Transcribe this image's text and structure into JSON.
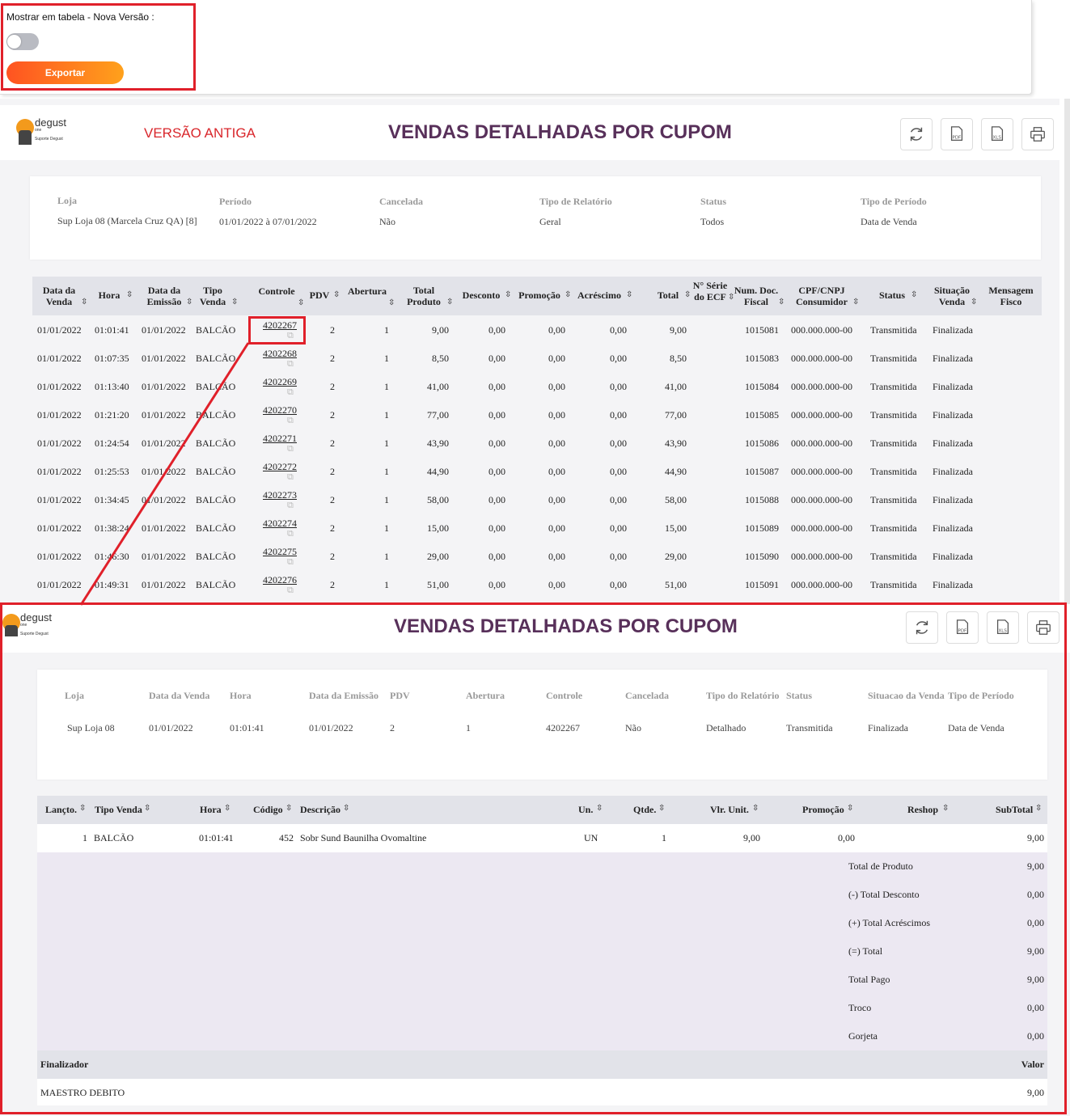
{
  "top": {
    "toggle_label": "Mostrar em tabela - Nova Versão :",
    "export_label": "Exportar"
  },
  "old": {
    "logo_text": "degust",
    "logo_sub": "one",
    "logo_caption": "Suporte Degust",
    "version_label": "VERSÃO ANTIGA",
    "title": "VENDAS DETALHADAS POR CUPOM",
    "filters": [
      {
        "label": "Loja",
        "value": "Sup Loja 08 (Marcela Cruz QA) [8]"
      },
      {
        "label": "Período",
        "value": "01/01/2022 à 07/01/2022"
      },
      {
        "label": "Cancelada",
        "value": "Não"
      },
      {
        "label": "Tipo de Relatório",
        "value": "Geral"
      },
      {
        "label": "Status",
        "value": "Todos"
      },
      {
        "label": "Tipo de Período",
        "value": "Data de Venda"
      }
    ],
    "columns": [
      "Data da Venda",
      "Hora",
      "Data da Emissão",
      "Tipo Venda",
      "Controle",
      "PDV",
      "Abertura",
      "Total Produto",
      "Desconto",
      "Promoção",
      "Acréscimo",
      "Total",
      "N° Série do ECF",
      "Num. Doc. Fiscal",
      "CPF/CNPJ Consumidor",
      "Status",
      "Situação Venda",
      "Mensagem Fisco"
    ],
    "rows": [
      [
        "01/01/2022",
        "01:01:41",
        "01/01/2022",
        "BALCÃO",
        "4202267",
        "2",
        "1",
        "9,00",
        "0,00",
        "0,00",
        "0,00",
        "9,00",
        "",
        "1015081",
        "000.000.000-00",
        "Transmitida",
        "Finalizada",
        ""
      ],
      [
        "01/01/2022",
        "01:07:35",
        "01/01/2022",
        "BALCÃO",
        "4202268",
        "2",
        "1",
        "8,50",
        "0,00",
        "0,00",
        "0,00",
        "8,50",
        "",
        "1015083",
        "000.000.000-00",
        "Transmitida",
        "Finalizada",
        ""
      ],
      [
        "01/01/2022",
        "01:13:40",
        "01/01/2022",
        "BALCÃO",
        "4202269",
        "2",
        "1",
        "41,00",
        "0,00",
        "0,00",
        "0,00",
        "41,00",
        "",
        "1015084",
        "000.000.000-00",
        "Transmitida",
        "Finalizada",
        ""
      ],
      [
        "01/01/2022",
        "01:21:20",
        "01/01/2022",
        "BALCÃO",
        "4202270",
        "2",
        "1",
        "77,00",
        "0,00",
        "0,00",
        "0,00",
        "77,00",
        "",
        "1015085",
        "000.000.000-00",
        "Transmitida",
        "Finalizada",
        ""
      ],
      [
        "01/01/2022",
        "01:24:54",
        "01/01/2022",
        "BALCÃO",
        "4202271",
        "2",
        "1",
        "43,90",
        "0,00",
        "0,00",
        "0,00",
        "43,90",
        "",
        "1015086",
        "000.000.000-00",
        "Transmitida",
        "Finalizada",
        ""
      ],
      [
        "01/01/2022",
        "01:25:53",
        "01/01/2022",
        "BALCÃO",
        "4202272",
        "2",
        "1",
        "44,90",
        "0,00",
        "0,00",
        "0,00",
        "44,90",
        "",
        "1015087",
        "000.000.000-00",
        "Transmitida",
        "Finalizada",
        ""
      ],
      [
        "01/01/2022",
        "01:34:45",
        "01/01/2022",
        "BALCÃO",
        "4202273",
        "2",
        "1",
        "58,00",
        "0,00",
        "0,00",
        "0,00",
        "58,00",
        "",
        "1015088",
        "000.000.000-00",
        "Transmitida",
        "Finalizada",
        ""
      ],
      [
        "01/01/2022",
        "01:38:24",
        "01/01/2022",
        "BALCÃO",
        "4202274",
        "2",
        "1",
        "15,00",
        "0,00",
        "0,00",
        "0,00",
        "15,00",
        "",
        "1015089",
        "000.000.000-00",
        "Transmitida",
        "Finalizada",
        ""
      ],
      [
        "01/01/2022",
        "01:46:30",
        "01/01/2022",
        "BALCÃO",
        "4202275",
        "2",
        "1",
        "29,00",
        "0,00",
        "0,00",
        "0,00",
        "29,00",
        "",
        "1015090",
        "000.000.000-00",
        "Transmitida",
        "Finalizada",
        ""
      ],
      [
        "01/01/2022",
        "01:49:31",
        "01/01/2022",
        "BALCÃO",
        "4202276",
        "2",
        "1",
        "51,00",
        "0,00",
        "0,00",
        "0,00",
        "51,00",
        "",
        "1015091",
        "000.000.000-00",
        "Transmitida",
        "Finalizada",
        ""
      ]
    ]
  },
  "detail": {
    "logo_text": "degust",
    "logo_sub": "one",
    "logo_caption": "Suporte Degust",
    "title": "VENDAS DETALHADAS POR CUPOM",
    "filters": [
      {
        "label": "Loja",
        "value": "Sup Loja 08"
      },
      {
        "label": "Data da Venda",
        "value": "01/01/2022"
      },
      {
        "label": "Hora",
        "value": "01:01:41"
      },
      {
        "label": "Data da Emissão",
        "value": "01/01/2022"
      },
      {
        "label": "PDV",
        "value": "2"
      },
      {
        "label": "Abertura",
        "value": "1"
      },
      {
        "label": "Controle",
        "value": "4202267"
      },
      {
        "label": "Cancelada",
        "value": "Não"
      },
      {
        "label": "Tipo do Relatório",
        "value": "Detalhado"
      },
      {
        "label": "Status",
        "value": "Transmitida"
      },
      {
        "label": "Situacao da Venda",
        "value": "Finalizada"
      },
      {
        "label": "Tipo de Período",
        "value": "Data de Venda"
      }
    ],
    "columns": [
      "Lançto.",
      "Tipo Venda",
      "Hora",
      "Código",
      "Descrição",
      "Un.",
      "Qtde.",
      "Vlr. Unit.",
      "Promoção",
      "Reshop",
      "SubTotal"
    ],
    "item": [
      "1",
      "BALCÃO",
      "01:01:41",
      "452",
      "Sobr Sund Baunilha Ovomaltine",
      "UN",
      "1",
      "9,00",
      "0,00",
      "",
      "9,00"
    ],
    "totals": [
      {
        "label": "Total de Produto",
        "value": "9,00"
      },
      {
        "label": "(-) Total Desconto",
        "value": "0,00"
      },
      {
        "label": "(+) Total Acréscimos",
        "value": "0,00"
      },
      {
        "label": "(=) Total",
        "value": "9,00"
      },
      {
        "label": "Total Pago",
        "value": "9,00"
      },
      {
        "label": "Troco",
        "value": "0,00"
      },
      {
        "label": "Gorjeta",
        "value": "0,00"
      }
    ],
    "finalizer_header": "Finalizador",
    "value_header": "Valor",
    "finalizer": "MAESTRO DEBITO",
    "finalizer_value": "9,00"
  },
  "icons": [
    "refresh-icon",
    "pdf-icon",
    "xls-icon",
    "print-icon",
    "sort-icon",
    "external-link-icon"
  ],
  "colors": {
    "accent_title": "#58305a",
    "export_gradient_start": "#ff5321",
    "export_gradient_end": "#ffa11c",
    "highlight_red": "#e0202a",
    "version_label_red": "#d9262b"
  }
}
